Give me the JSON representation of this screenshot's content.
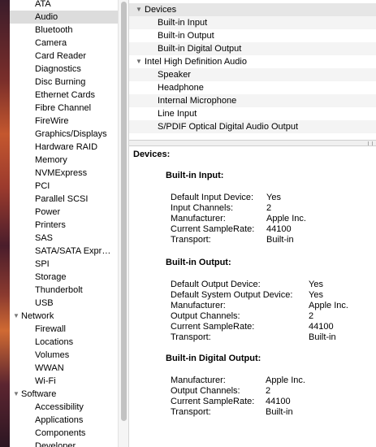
{
  "sidebar": {
    "items": [
      {
        "label": "ATA",
        "kind": "child"
      },
      {
        "label": "Audio",
        "kind": "child",
        "selected": true
      },
      {
        "label": "Bluetooth",
        "kind": "child"
      },
      {
        "label": "Camera",
        "kind": "child"
      },
      {
        "label": "Card Reader",
        "kind": "child"
      },
      {
        "label": "Diagnostics",
        "kind": "child"
      },
      {
        "label": "Disc Burning",
        "kind": "child"
      },
      {
        "label": "Ethernet Cards",
        "kind": "child"
      },
      {
        "label": "Fibre Channel",
        "kind": "child"
      },
      {
        "label": "FireWire",
        "kind": "child"
      },
      {
        "label": "Graphics/Displays",
        "kind": "child"
      },
      {
        "label": "Hardware RAID",
        "kind": "child"
      },
      {
        "label": "Memory",
        "kind": "child"
      },
      {
        "label": "NVMExpress",
        "kind": "child"
      },
      {
        "label": "PCI",
        "kind": "child"
      },
      {
        "label": "Parallel SCSI",
        "kind": "child"
      },
      {
        "label": "Power",
        "kind": "child"
      },
      {
        "label": "Printers",
        "kind": "child"
      },
      {
        "label": "SAS",
        "kind": "child"
      },
      {
        "label": "SATA/SATA Expr…",
        "kind": "child"
      },
      {
        "label": "SPI",
        "kind": "child"
      },
      {
        "label": "Storage",
        "kind": "child"
      },
      {
        "label": "Thunderbolt",
        "kind": "child"
      },
      {
        "label": "USB",
        "kind": "child"
      },
      {
        "label": "Network",
        "kind": "section"
      },
      {
        "label": "Firewall",
        "kind": "child"
      },
      {
        "label": "Locations",
        "kind": "child"
      },
      {
        "label": "Volumes",
        "kind": "child"
      },
      {
        "label": "WWAN",
        "kind": "child"
      },
      {
        "label": "Wi-Fi",
        "kind": "child"
      },
      {
        "label": "Software",
        "kind": "section"
      },
      {
        "label": "Accessibility",
        "kind": "child"
      },
      {
        "label": "Applications",
        "kind": "child"
      },
      {
        "label": "Components",
        "kind": "child"
      },
      {
        "label": "Developer",
        "kind": "child"
      }
    ]
  },
  "device_tree": [
    {
      "label": "Devices",
      "kind": "group"
    },
    {
      "label": "Built-in Input",
      "kind": "leaf"
    },
    {
      "label": "Built-in Output",
      "kind": "leaf"
    },
    {
      "label": "Built-in Digital Output",
      "kind": "leaf"
    },
    {
      "label": "Intel High Definition Audio",
      "kind": "group"
    },
    {
      "label": "Speaker",
      "kind": "leaf"
    },
    {
      "label": "Headphone",
      "kind": "leaf"
    },
    {
      "label": "Internal Microphone",
      "kind": "leaf"
    },
    {
      "label": "Line Input",
      "kind": "leaf"
    },
    {
      "label": "S/PDIF Optical Digital Audio Output",
      "kind": "leaf"
    }
  ],
  "detail": {
    "heading": "Devices:",
    "sections": [
      {
        "title": "Built-in Input:",
        "props": [
          {
            "key": "Default Input Device:",
            "value": "Yes"
          },
          {
            "key": "Input Channels:",
            "value": "2"
          },
          {
            "key": "Manufacturer:",
            "value": "Apple Inc."
          },
          {
            "key": "Current SampleRate:",
            "value": "44100"
          },
          {
            "key": "Transport:",
            "value": "Built-in"
          }
        ]
      },
      {
        "title": "Built-in Output:",
        "props": [
          {
            "key": "Default Output Device:",
            "value": "Yes"
          },
          {
            "key": "Default System Output Device:",
            "value": "Yes"
          },
          {
            "key": "Manufacturer:",
            "value": "Apple Inc."
          },
          {
            "key": "Output Channels:",
            "value": "2"
          },
          {
            "key": "Current SampleRate:",
            "value": "44100"
          },
          {
            "key": "Transport:",
            "value": "Built-in"
          }
        ]
      },
      {
        "title": "Built-in Digital Output:",
        "props": [
          {
            "key": "Manufacturer:",
            "value": "Apple Inc."
          },
          {
            "key": "Output Channels:",
            "value": "2"
          },
          {
            "key": "Current SampleRate:",
            "value": "44100"
          },
          {
            "key": "Transport:",
            "value": "Built-in"
          }
        ]
      }
    ]
  },
  "icons": {
    "expanded": "disclosure-triangle-down-icon"
  }
}
